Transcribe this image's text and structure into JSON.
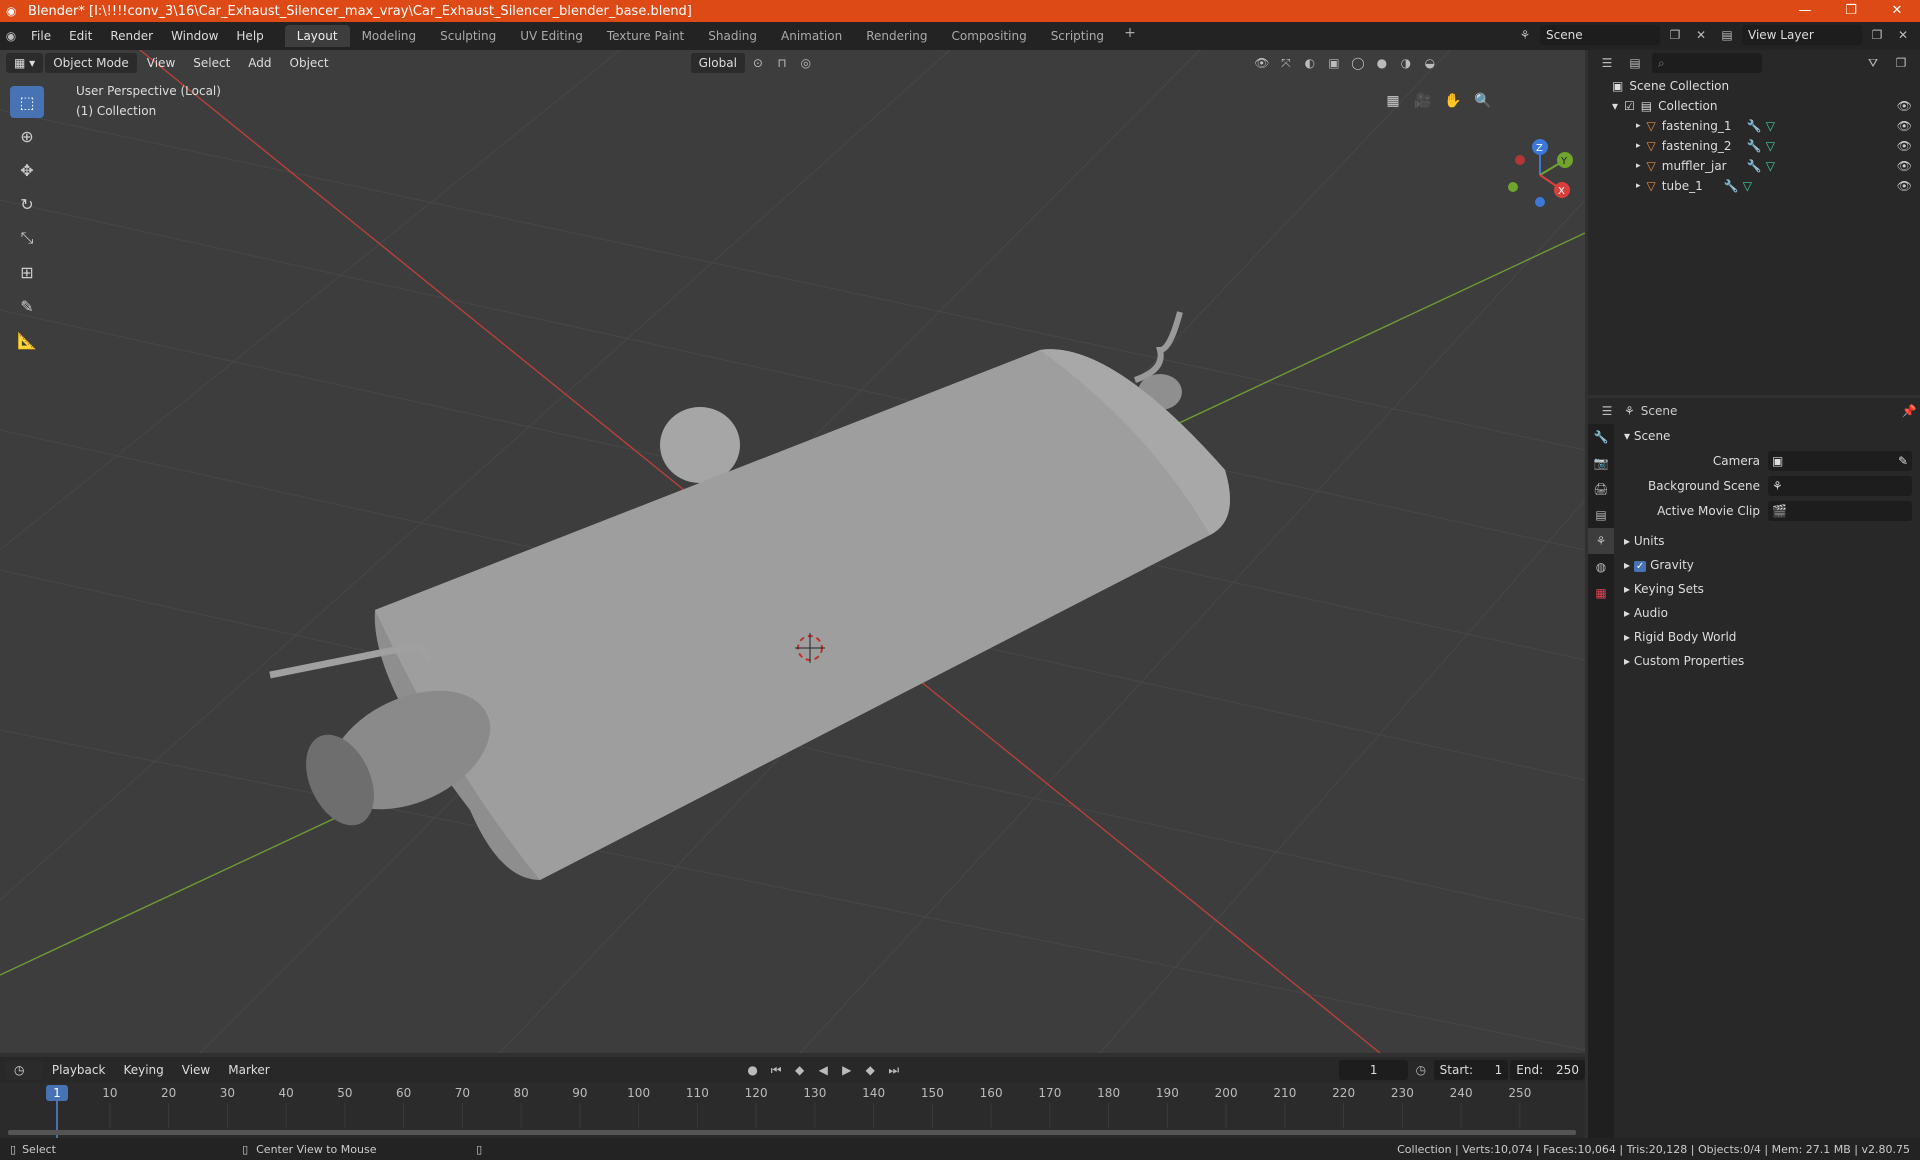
{
  "window": {
    "title": "Blender* [I:\\!!!!conv_3\\16\\Car_Exhaust_Silencer_max_vray\\Car_Exhaust_Silencer_blender_base.blend]",
    "minimize": "—",
    "restore": "❐",
    "close": "✕"
  },
  "menus": [
    "File",
    "Edit",
    "Render",
    "Window",
    "Help"
  ],
  "workspaces": [
    "Layout",
    "Modeling",
    "Sculpting",
    "UV Editing",
    "Texture Paint",
    "Shading",
    "Animation",
    "Rendering",
    "Compositing",
    "Scripting"
  ],
  "topright": {
    "scene": "Scene",
    "view_layer": "View Layer"
  },
  "viewport": {
    "mode": "Object Mode",
    "menus": [
      "View",
      "Select",
      "Add",
      "Object"
    ],
    "transform": "Global",
    "info_line1": "User Perspective (Local)",
    "info_line2": "(1) Collection",
    "gizmo": {
      "z": "Z",
      "y": "Y",
      "x": "X"
    }
  },
  "outliner": {
    "root": "Scene Collection",
    "collection": "Collection",
    "items": [
      "fastening_1",
      "fastening_2",
      "muffler_jar",
      "tube_1"
    ]
  },
  "properties": {
    "header": "Scene",
    "section": "Scene",
    "fields": [
      {
        "label": "Camera"
      },
      {
        "label": "Background Scene"
      },
      {
        "label": "Active Movie Clip"
      }
    ],
    "subsections": [
      "Units",
      "Gravity",
      "Keying Sets",
      "Audio",
      "Rigid Body World",
      "Custom Properties"
    ]
  },
  "timeline": {
    "menus": [
      "Playback",
      "Keying",
      "View",
      "Marker"
    ],
    "current_frame": "1",
    "start_label": "Start:",
    "start": "1",
    "end_label": "End:",
    "end": "250",
    "ticks": [
      "1",
      "10",
      "20",
      "30",
      "40",
      "50",
      "60",
      "70",
      "80",
      "90",
      "100",
      "110",
      "120",
      "130",
      "140",
      "150",
      "160",
      "170",
      "180",
      "190",
      "200",
      "210",
      "220",
      "230",
      "240",
      "250"
    ]
  },
  "statusbar": {
    "select": "Select",
    "center": "Center View to Mouse",
    "stats": "Collection | Verts:10,074 | Faces:10,064 | Tris:20,128 | Objects:0/4 | Mem: 27.1 MB | v2.80.75"
  },
  "colors": {
    "titlebar": "#dd4a16",
    "accent": "#4772b3",
    "x_axis": "#c0392b",
    "y_axis": "#7fb03a"
  }
}
